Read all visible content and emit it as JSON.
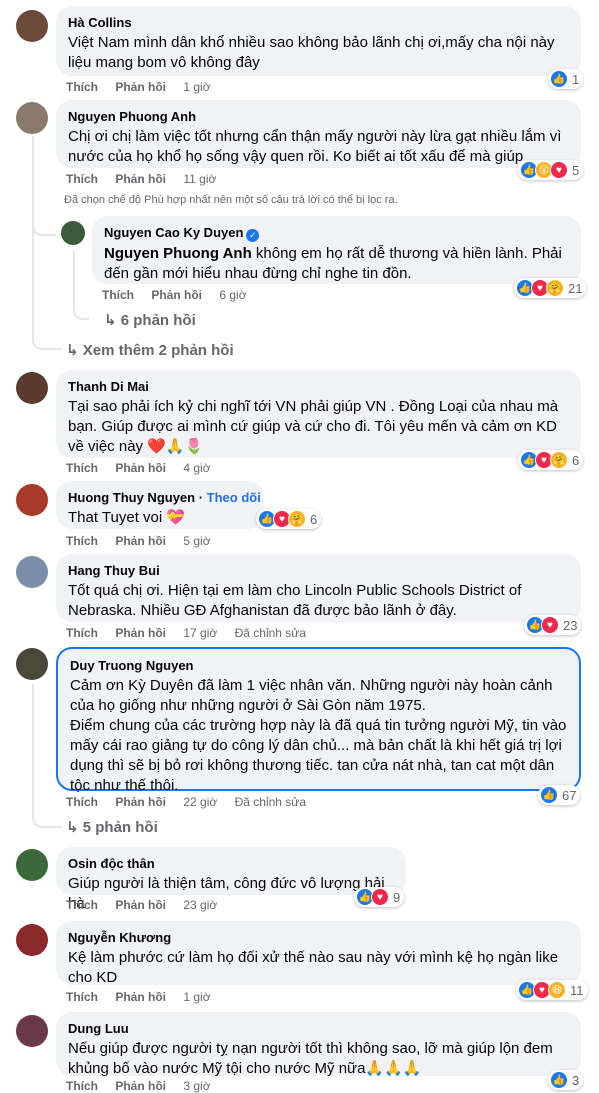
{
  "labels": {
    "like": "Thích",
    "reply": "Phản hồi",
    "edited": "Đã chỉnh sửa",
    "follow": "Theo dõi"
  },
  "comments": [
    {
      "name": "Hà Collins",
      "text": "Việt Nam mình dân khổ nhiều sao không bảo lãnh chị ơi,mấy cha nội này liệu mang bom vô không đây",
      "time": "1 giờ",
      "reactions": [
        "like"
      ],
      "count": "1"
    },
    {
      "name": "Nguyen Phuong Anh",
      "text": "Chị ơi chị làm việc tốt nhưng cẩn thận mấy người này lừa gạt nhiều lắm vì nước của họ khổ họ sống vậy quen rồi. Ko biết ai tốt xấu để mà giúp",
      "time": "11 giờ",
      "reactions": [
        "like",
        "wow",
        "love"
      ],
      "count": "5"
    },
    {
      "name": "Nguyen Cao Ky Duyen",
      "mention": "Nguyen Phuong Anh",
      "text": " không em họ rất dễ thương và hiền lành. Phải đến gần mới hiểu nhau đừng chỉ nghe tin đồn.",
      "time": "6 giờ",
      "reactions": [
        "like",
        "love",
        "care"
      ],
      "count": "21",
      "replies_label": "6 phản hồi"
    },
    {
      "name": "Thanh Di Mai",
      "text": "Tại sao phải ích kỷ chi nghĩ tới VN phải giúp VN . Đồng Loại của nhau mà bạn. Giúp được ai mình cứ giúp và cứ cho đi. Tôi yêu mến và cảm ơn KD về việc này ❤️🙏🌷",
      "time": "4 giờ",
      "reactions": [
        "like",
        "love",
        "care"
      ],
      "count": "6"
    },
    {
      "name": "Huong Thuy Nguyen",
      "text": "That Tuyet voi 💝",
      "time": "5 giờ",
      "reactions": [
        "like",
        "love",
        "care"
      ],
      "count": "6"
    },
    {
      "name": "Hang Thuy Bui",
      "text": "Tốt quá chị ơi. Hiện tại em làm cho Lincoln Public Schools District of Nebraska. Nhiều GĐ Afghanistan đã được bảo lãnh ở đây.",
      "time": "17 giờ",
      "reactions": [
        "like",
        "love"
      ],
      "count": "23"
    },
    {
      "name": "Duy Truong Nguyen",
      "text": "Cảm ơn Kỳ Duyên đã làm 1 việc nhân văn. Những người này hoàn cảnh của họ giống như những người ở Sài Gòn năm 1975.\nĐiểm chung của các trường hợp này là đã quá tin tưởng người Mỹ, tin vào mấy cái rao giảng tự do công lý dân chủ... mà bản chất là khi hết giá trị lợi dụng thì sẽ bị bỏ rơi không thương tiếc. tan cửa nát nhà, tan cat một dân tộc như thế thôi.",
      "time": "22 giờ",
      "reactions": [
        "like"
      ],
      "count": "67",
      "replies_label": "5 phản hồi"
    },
    {
      "name": "Osin độc thân",
      "text": "Giúp người là thiện tâm, công đức vô lượng hải hà",
      "time": "23 giờ",
      "reactions": [
        "like",
        "love"
      ],
      "count": "9"
    },
    {
      "name": "Nguyễn Khương",
      "text": "Kệ làm phước cứ làm họ đối xử thế nào sau này với mình kệ họ ngàn like cho KD",
      "time": "1 giờ",
      "reactions": [
        "like",
        "love",
        "haha"
      ],
      "count": "11"
    },
    {
      "name": "Dung Luu",
      "text": "Nếu giúp được người tỵ nạn người tốt thì không sao, lỡ mà giúp lộn đem khủng bố vào nước Mỹ tội cho nước Mỹ nữa🙏🙏🙏",
      "time": "3 giờ",
      "reactions": [
        "like"
      ],
      "count": "3"
    }
  ],
  "filter_note": "Đã chọn chế độ Phù hợp nhất nên một số câu trả lời có thể bị lọc ra.",
  "see_more": "Xem thêm 2 phản hồi"
}
